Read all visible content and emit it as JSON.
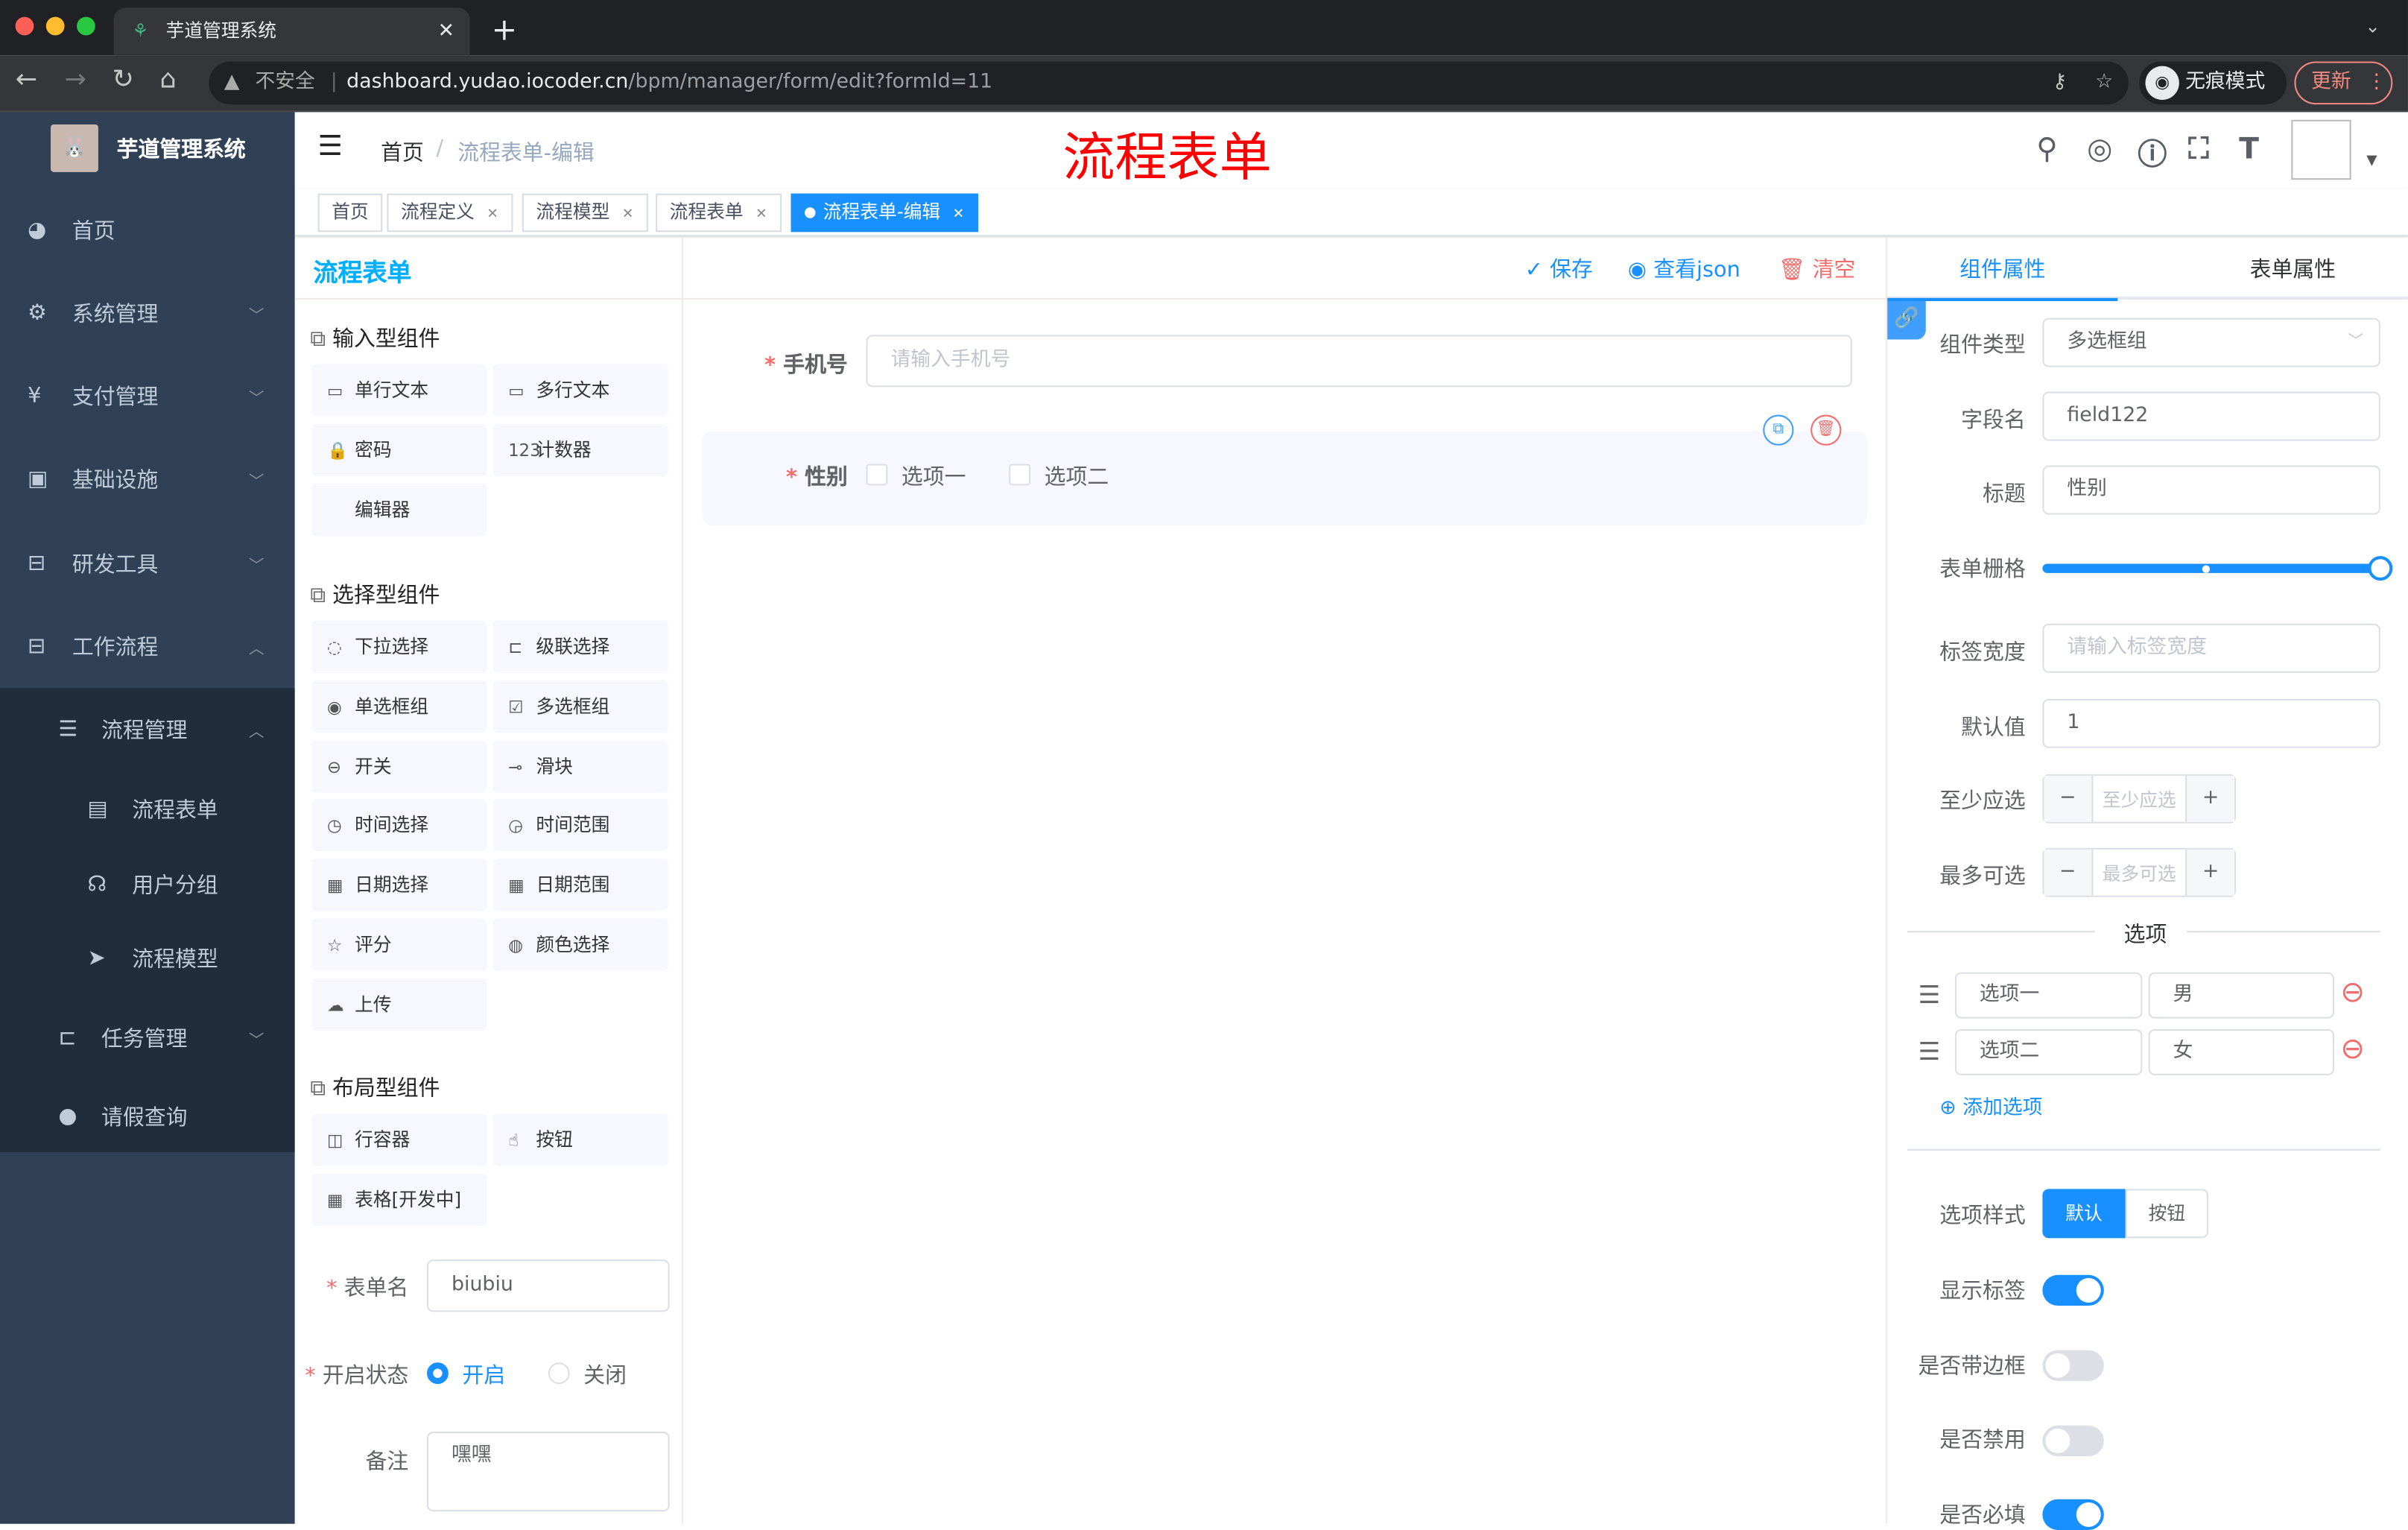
{
  "browser": {
    "tab_title": "芋道管理系统",
    "security": "不安全",
    "url_host": "dashboard.yudao.iocoder.cn",
    "url_path": "/bpm/manager/form/edit?formId=11",
    "incognito": "无痕模式",
    "update": "更新"
  },
  "sidebar": {
    "logo_title": "芋道管理系统",
    "items": [
      {
        "label": "首页",
        "icon": "dashboard-icon"
      },
      {
        "label": "系统管理",
        "icon": "gear-icon"
      },
      {
        "label": "支付管理",
        "icon": "yen-icon"
      },
      {
        "label": "基础设施",
        "icon": "monitor-icon"
      },
      {
        "label": "研发工具",
        "icon": "toolbox-icon"
      },
      {
        "label": "工作流程",
        "icon": "toolbox-icon"
      }
    ],
    "sub": [
      {
        "label": "流程管理"
      },
      {
        "label": "流程表单"
      },
      {
        "label": "用户分组"
      },
      {
        "label": "流程模型"
      },
      {
        "label": "任务管理"
      },
      {
        "label": "请假查询"
      }
    ]
  },
  "header": {
    "breadcrumb_home": "首页",
    "breadcrumb_current": "流程表单-编辑",
    "overlay_title": "流程表单"
  },
  "tags": [
    "首页",
    "流程定义",
    "流程模型",
    "流程表单",
    "流程表单-编辑"
  ],
  "left": {
    "title": "流程表单",
    "groups": [
      {
        "title": "输入型组件",
        "items": [
          "单行文本",
          "多行文本",
          "密码",
          "计数器",
          "编辑器"
        ]
      },
      {
        "title": "选择型组件",
        "items": [
          "下拉选择",
          "级联选择",
          "单选框组",
          "多选框组",
          "开关",
          "滑块",
          "时间选择",
          "时间范围",
          "日期选择",
          "日期范围",
          "评分",
          "颜色选择",
          "上传"
        ]
      },
      {
        "title": "布局型组件",
        "items": [
          "行容器",
          "按钮",
          "表格[开发中]"
        ]
      }
    ],
    "form_name_label": "表单名",
    "form_name": "biubiu",
    "status_label": "开启状态",
    "status_on": "开启",
    "status_off": "关闭",
    "remark_label": "备注",
    "remark": "嘿嘿"
  },
  "center": {
    "save": "保存",
    "view_json": "查看json",
    "clear": "清空",
    "phone_label": "手机号",
    "phone_placeholder": "请输入手机号",
    "gender_label": "性别",
    "option1": "选项一",
    "option2": "选项二"
  },
  "right": {
    "tab_component": "组件属性",
    "tab_form": "表单属性",
    "type_label": "组件类型",
    "type_value": "多选框组",
    "field_label": "字段名",
    "field_value": "field122",
    "title_label": "标题",
    "title_value": "性别",
    "grid_label": "表单栅格",
    "grid_value": 24,
    "grid_max": 24,
    "label_width_label": "标签宽度",
    "label_width_placeholder": "请输入标签宽度",
    "default_label": "默认值",
    "default_value": "1",
    "min_label": "至少应选",
    "min_placeholder": "至少应选",
    "max_label": "最多可选",
    "max_placeholder": "最多可选",
    "options_divider": "选项",
    "options": [
      {
        "label": "选项一",
        "value": "男"
      },
      {
        "label": "选项二",
        "value": "女"
      }
    ],
    "add_option": "添加选项",
    "style_label": "选项样式",
    "style_default": "默认",
    "style_button": "按钮",
    "show_label": "显示标签",
    "show_label_on": true,
    "border_label": "是否带边框",
    "border_on": false,
    "disabled_label": "是否禁用",
    "disabled_on": false,
    "required_label": "是否必填",
    "required_on": true
  },
  "colors": {
    "primary": "#1890ff",
    "sidebar": "#304156",
    "danger": "#f56c6c",
    "title_red": "#ff0000"
  }
}
